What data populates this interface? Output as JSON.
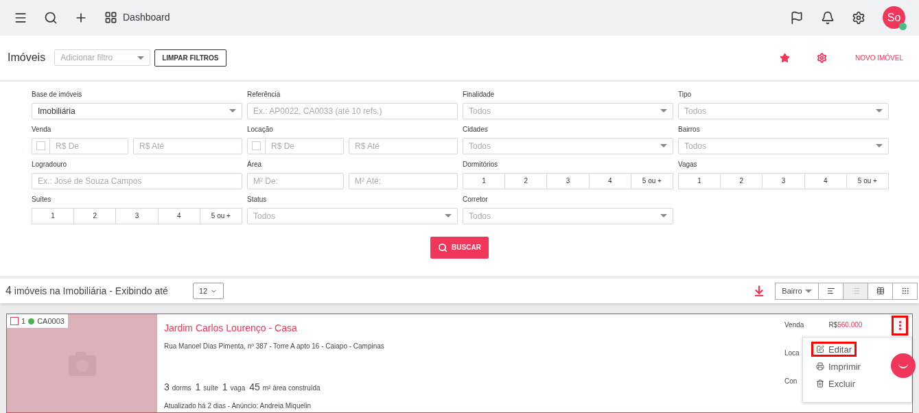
{
  "topbar": {
    "dashboard": "Dashboard",
    "avatar": "So",
    "online": true
  },
  "header": {
    "title": "Imóveis",
    "filter_placeholder": "Adicionar filtro",
    "clear": "LIMPAR FILTROS",
    "new": "NOVO IMÓVEL"
  },
  "filters": [
    {
      "kind": "select",
      "label": "Base de imóveis",
      "value": "Imobiliária"
    },
    {
      "kind": "text",
      "label": "Referência",
      "placeholder": "Ex.: AP0022, CA0033 (até 10 refs.)"
    },
    {
      "kind": "select",
      "label": "Finalidade",
      "placeholder": "Todos"
    },
    {
      "kind": "select",
      "label": "Tipo",
      "placeholder": "Todos"
    },
    {
      "kind": "range",
      "label": "Venda",
      "checked": false,
      "from": {
        "placeholder": "R$ De"
      },
      "to": {
        "placeholder": "R$ Até"
      }
    },
    {
      "kind": "range",
      "label": "Locação",
      "checked": false,
      "from": {
        "placeholder": "R$ De"
      },
      "to": {
        "placeholder": "R$ Até"
      }
    },
    {
      "kind": "select",
      "label": "Cidades",
      "placeholder": "Todos"
    },
    {
      "kind": "select",
      "label": "Bairros",
      "placeholder": "Todos"
    },
    {
      "kind": "text",
      "label": "Logradouro",
      "placeholder": "Ex.: José de Souza Campos"
    },
    {
      "kind": "range",
      "label": "Área",
      "from": {
        "placeholder": "M² De:"
      },
      "to": {
        "placeholder": "M² Até:"
      }
    },
    {
      "kind": "buttons",
      "label": "Dormitórios",
      "options": [
        {
          "label": "1",
          "selected": false
        },
        {
          "label": "2",
          "selected": false
        },
        {
          "label": "3",
          "selected": false
        },
        {
          "label": "4",
          "selected": false
        },
        {
          "label": "5 ou +",
          "selected": false
        }
      ]
    },
    {
      "kind": "buttons",
      "label": "Vagas",
      "options": [
        {
          "label": "1",
          "selected": false
        },
        {
          "label": "2",
          "selected": false
        },
        {
          "label": "3",
          "selected": false
        },
        {
          "label": "4",
          "selected": false
        },
        {
          "label": "5 ou +",
          "selected": false
        }
      ]
    },
    {
      "kind": "buttons",
      "label": "Suítes",
      "options": [
        {
          "label": "1",
          "selected": false
        },
        {
          "label": "2",
          "selected": false
        },
        {
          "label": "3",
          "selected": false
        },
        {
          "label": "4",
          "selected": false
        },
        {
          "label": "5 ou +",
          "selected": false
        }
      ]
    },
    {
      "kind": "select",
      "label": "Status",
      "placeholder": "Todos"
    },
    {
      "kind": "select",
      "label": "Corretor",
      "placeholder": "Todos"
    }
  ],
  "search_button": "BUSCAR",
  "results": {
    "count": "4",
    "text": "imóveis na Imobiliária - Exibindo até",
    "per_page": "12",
    "sort": "Bairro",
    "views": [
      {
        "kind": "tree",
        "selected": false
      },
      {
        "kind": "list",
        "selected": true
      },
      {
        "kind": "table",
        "selected": false
      },
      {
        "kind": "grid",
        "selected": false
      }
    ]
  },
  "card": {
    "checked": false,
    "index": "1",
    "color": "#4caf50",
    "ref": "CA0003",
    "title": "Jardim Carlos Lourenço - Casa",
    "address": "Rua Manoel Dias Pimenta, nº 387 - Torre A apto 16 - Caiapo - Campinas",
    "stats": [
      {
        "value": "3",
        "unit": "dorms"
      },
      {
        "value": "1",
        "unit": "suíte"
      },
      {
        "value": "1",
        "unit": "vaga"
      },
      {
        "value": "45",
        "unit": "m² área construída"
      }
    ],
    "updated": "Atualizado há 2 dias - Anúncio: Andreia Miquelin",
    "prices": [
      {
        "label": "Venda",
        "currency": "R$",
        "value": "560.000"
      },
      {
        "label": "Loca"
      },
      {
        "label": "Con"
      }
    ],
    "menu_highlighted": true,
    "menu": [
      {
        "kind": "edit",
        "label": "Editar",
        "selected": true
      },
      {
        "kind": "print",
        "label": "Imprimir",
        "selected": false
      },
      {
        "kind": "delete",
        "label": "Excluir",
        "selected": false
      }
    ]
  }
}
